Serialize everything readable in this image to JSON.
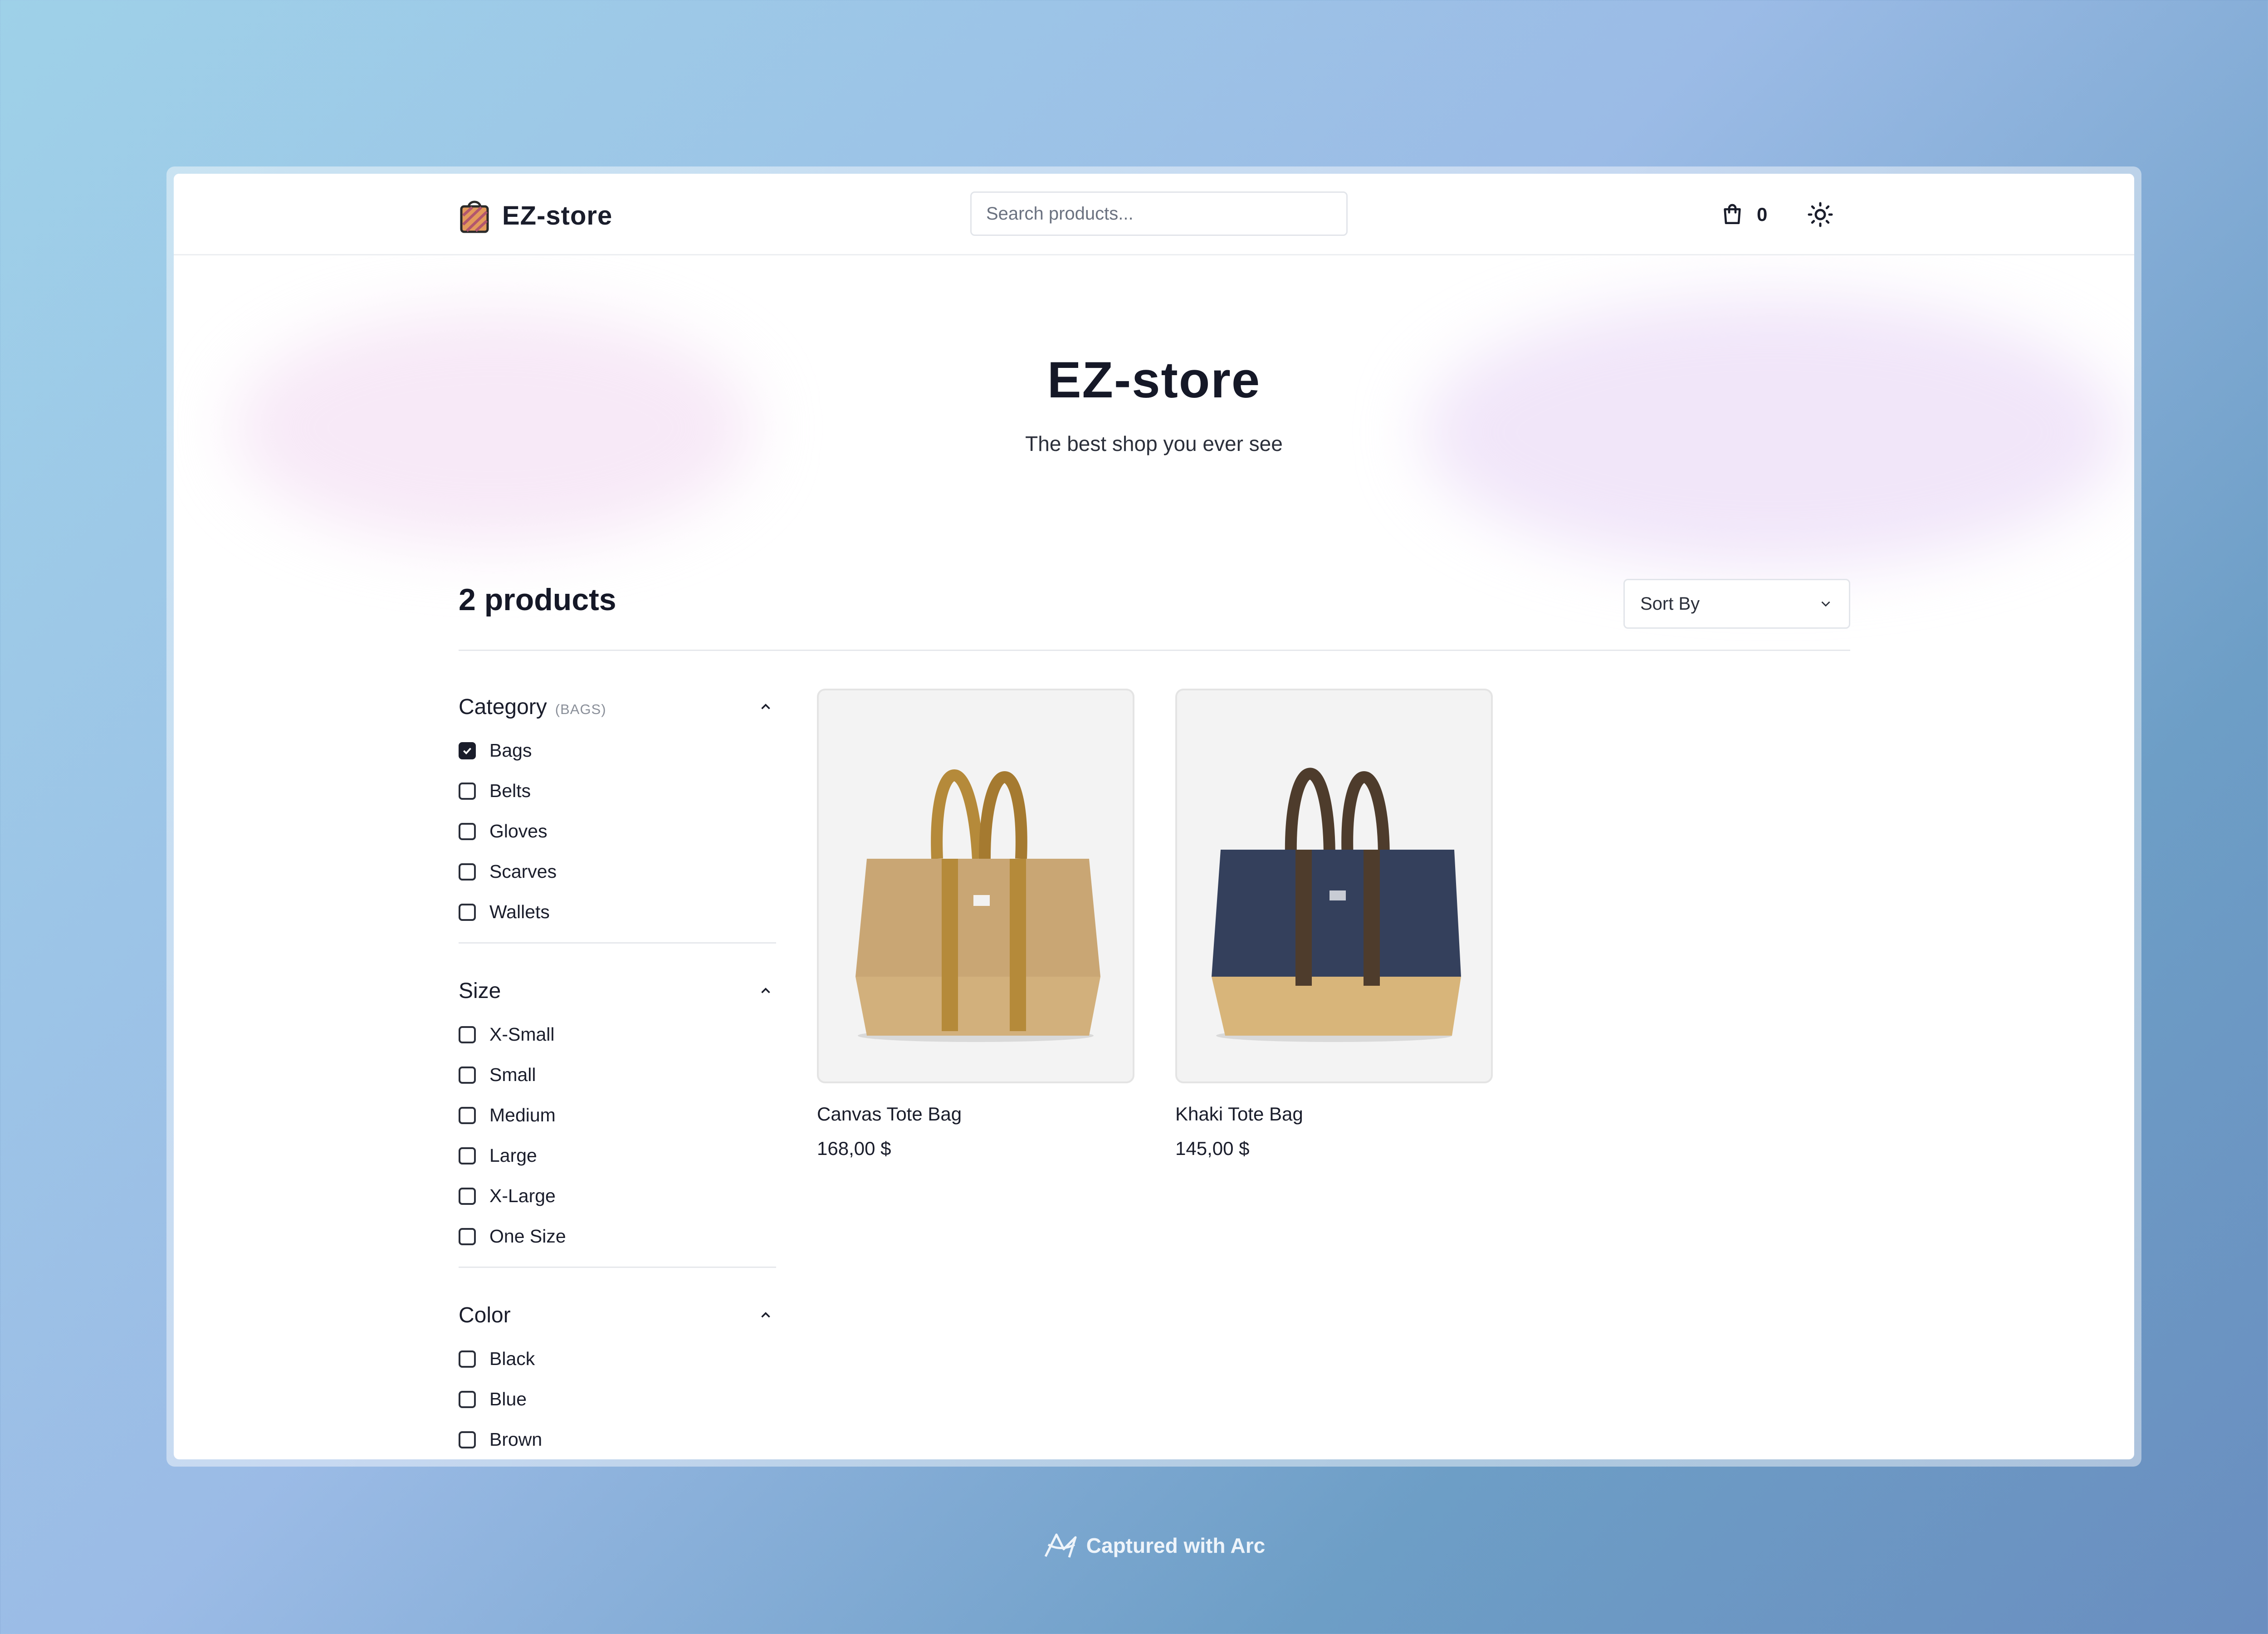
{
  "header": {
    "store_name": "EZ-store",
    "search_placeholder": "Search products...",
    "cart_count": "0"
  },
  "hero": {
    "title": "EZ-store",
    "subtitle": "The best shop you ever see"
  },
  "toolbar": {
    "count_label": "2 products",
    "sort_label": "Sort By"
  },
  "filters": {
    "category": {
      "title": "Category",
      "selected_tag": "(BAGS)",
      "options": [
        {
          "label": "Bags",
          "checked": true
        },
        {
          "label": "Belts",
          "checked": false
        },
        {
          "label": "Gloves",
          "checked": false
        },
        {
          "label": "Scarves",
          "checked": false
        },
        {
          "label": "Wallets",
          "checked": false
        }
      ]
    },
    "size": {
      "title": "Size",
      "options": [
        {
          "label": "X-Small",
          "checked": false
        },
        {
          "label": "Small",
          "checked": false
        },
        {
          "label": "Medium",
          "checked": false
        },
        {
          "label": "Large",
          "checked": false
        },
        {
          "label": "X-Large",
          "checked": false
        },
        {
          "label": "One Size",
          "checked": false
        }
      ]
    },
    "color": {
      "title": "Color",
      "options": [
        {
          "label": "Black",
          "checked": false
        },
        {
          "label": "Blue",
          "checked": false
        },
        {
          "label": "Brown",
          "checked": false
        }
      ]
    }
  },
  "products": [
    {
      "name": "Canvas Tote Bag",
      "price": "168,00 $",
      "body_color": "#c9a674",
      "strap_color": "#b58a3a",
      "base_color": "#d2b07c"
    },
    {
      "name": "Khaki Tote Bag",
      "price": "145,00 $",
      "body_color": "#34405c",
      "strap_color": "#4e3c2c",
      "base_color": "#d8b57a"
    }
  ],
  "footer": {
    "capture_label": "Captured with Arc"
  },
  "colors": {
    "text": "#1a1d2b",
    "border": "#e6e8ec",
    "checkbox_checked": "#1a1d2b"
  },
  "icons": {
    "logo": "shopping-bag-icon",
    "cart": "cart-icon",
    "theme": "sun-icon",
    "sort": "chevron-down-icon",
    "collapse": "chevron-up-icon"
  }
}
